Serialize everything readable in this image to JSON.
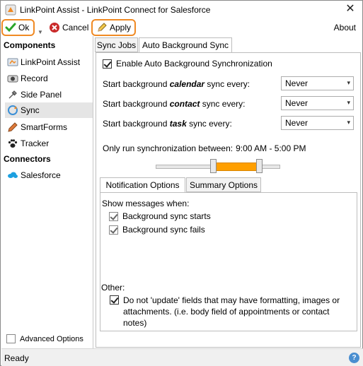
{
  "window": {
    "title": "LinkPoint Assist - LinkPoint Connect for Salesforce"
  },
  "toolbar": {
    "ok_label": "Ok",
    "cancel_label": "Cancel",
    "apply_label": "Apply",
    "about_label": "About"
  },
  "nav": {
    "components_header": "Components",
    "items": [
      {
        "label": "LinkPoint Assist",
        "icon": "linkpoint-icon"
      },
      {
        "label": "Record",
        "icon": "record-icon"
      },
      {
        "label": "Side Panel",
        "icon": "side-panel-icon"
      },
      {
        "label": "Sync",
        "icon": "sync-icon",
        "selected": true
      },
      {
        "label": "SmartForms",
        "icon": "pencil-icon"
      },
      {
        "label": "Tracker",
        "icon": "paw-icon"
      }
    ],
    "connectors_header": "Connectors",
    "connectors": [
      {
        "label": "Salesforce",
        "icon": "salesforce-cloud-icon"
      }
    ],
    "advanced_options_label": "Advanced Options",
    "advanced_options_checked": false
  },
  "tabs": [
    {
      "label": "Sync Jobs",
      "active": false
    },
    {
      "label": "Auto Background Sync",
      "active": true
    }
  ],
  "auto_sync": {
    "enable_label": "Enable Auto Background Synchronization",
    "enable_checked": true,
    "calendar": {
      "prefix": "Start background ",
      "keyword": "calendar",
      "suffix": " sync every:",
      "value": "Never"
    },
    "contact": {
      "prefix": "Start background ",
      "keyword": "contact",
      "suffix": " sync every:",
      "value": "Never"
    },
    "task": {
      "prefix": "Start background ",
      "keyword": "task",
      "suffix": " sync every:",
      "value": "Never"
    },
    "window_label": "Only run synchronization between:",
    "window_value": "9:00 AM - 5:00 PM"
  },
  "subtabs": [
    {
      "label": "Notification Options",
      "active": true
    },
    {
      "label": "Summary Options",
      "active": false
    }
  ],
  "notifications": {
    "show_label": "Show messages when:",
    "starts_label": "Background sync starts",
    "starts_checked": true,
    "fails_label": "Background sync fails",
    "fails_checked": true,
    "other_label": "Other:",
    "no_update_label": "Do not 'update' fields that may have formatting, images or attachments. (i.e. body field of appointments or contact notes)",
    "no_update_checked": true
  },
  "status": {
    "text": "Ready"
  },
  "colors": {
    "accent": "#f08a24",
    "slider_range": "#ff9f00"
  }
}
